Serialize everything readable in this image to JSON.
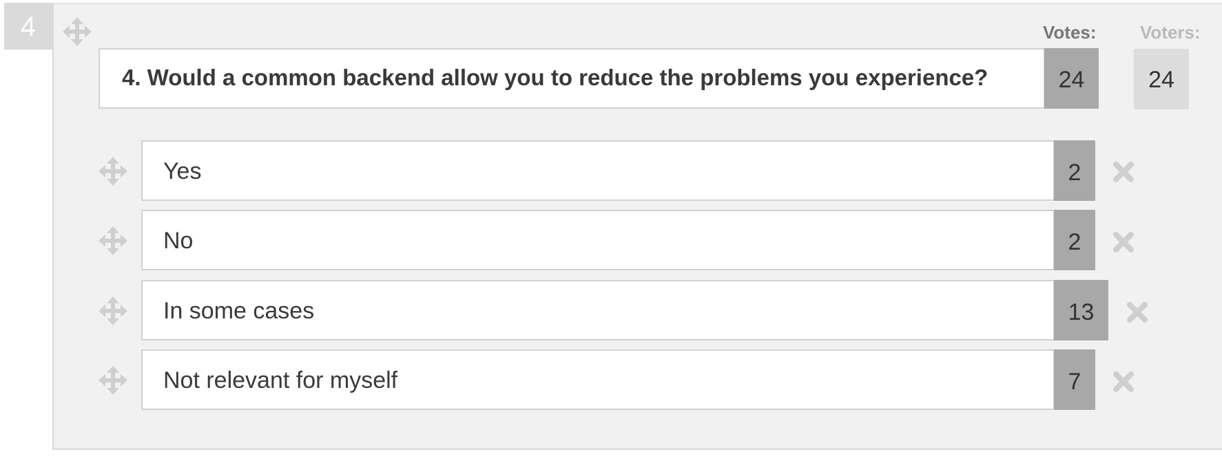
{
  "question": {
    "index": "4",
    "text": "4. Would a common backend allow you to reduce the problems you experience?",
    "votes": "24",
    "voters": "24"
  },
  "headers": {
    "votes": "Votes:",
    "voters": "Voters:"
  },
  "answers": [
    {
      "label": "Yes",
      "count": "2"
    },
    {
      "label": "No",
      "count": "2"
    },
    {
      "label": "In some cases",
      "count": "13"
    },
    {
      "label": "Not relevant for myself",
      "count": "7"
    }
  ],
  "icons": {
    "drag": "move-arrows-icon",
    "remove": "close-x-icon"
  },
  "colors": {
    "panel_bg": "#f1f1f1",
    "count_bg": "#a8a8a8",
    "voters_bg": "#dcdcdc",
    "icon_gray": "#cfcfcf"
  }
}
